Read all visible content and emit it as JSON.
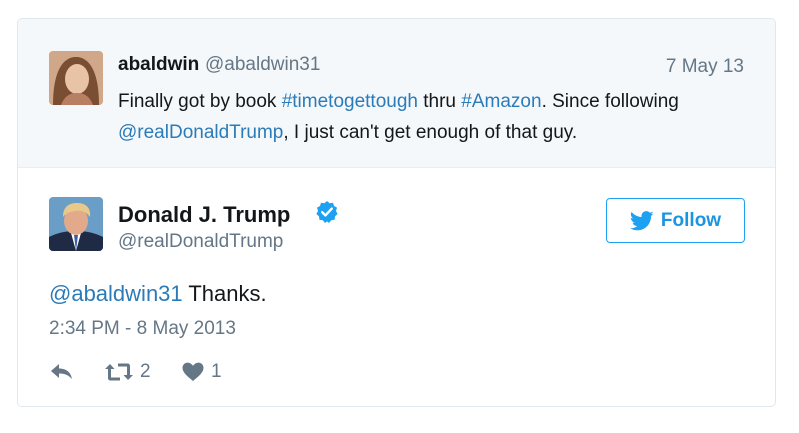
{
  "quoted": {
    "name": "abaldwin",
    "handle": "@abaldwin31",
    "date": "7 May 13",
    "text_1": "Finally got by book ",
    "hashtag_1": "#timetogettough",
    "text_2": " thru ",
    "hashtag_2": "#Amazon",
    "text_3": ". Since following ",
    "mention": "@realDonaldTrump",
    "text_4": ", I just can't get enough of that guy."
  },
  "tweet": {
    "name": "Donald J. Trump",
    "handle": "@realDonaldTrump",
    "follow_label": "Follow",
    "reply_mention": "@abaldwin31",
    "text": " Thanks.",
    "timestamp": "2:34 PM - 8 May 2013",
    "retweet_count": "2",
    "like_count": "1"
  },
  "colors": {
    "link": "#2b7bb9",
    "follow_border": "#1da1f2",
    "muted": "#657786",
    "quoted_bg": "#f5f8fa"
  }
}
